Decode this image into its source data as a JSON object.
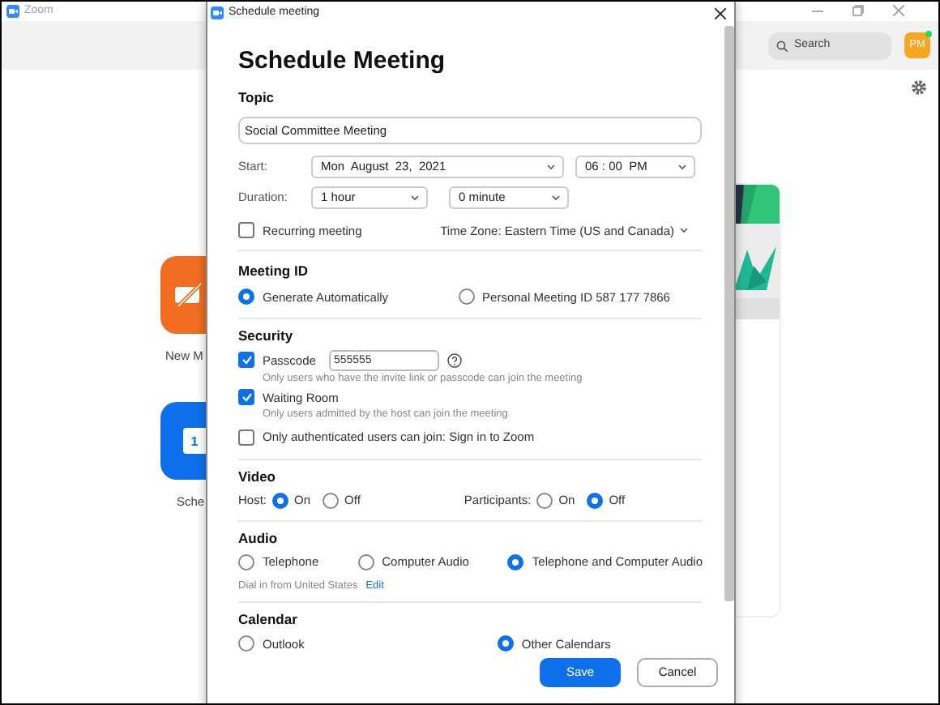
{
  "app": {
    "title": "Zoom",
    "search": {
      "placeholder": "Search"
    },
    "avatar": "PM",
    "tiles": [
      {
        "kind": "new-meeting",
        "label": "New M"
      },
      {
        "kind": "schedule",
        "label": "Sche",
        "badge": "1"
      }
    ]
  },
  "dialog": {
    "title": "Schedule meeting",
    "heading": "Schedule Meeting",
    "topic": {
      "label": "Topic",
      "value": "Social Committee Meeting"
    },
    "start": {
      "label": "Start:",
      "date": "Mon  August  23,  2021",
      "time": "06 : 00  PM"
    },
    "duration": {
      "label": "Duration:",
      "hours": "1 hour",
      "minutes": "0 minute"
    },
    "recurring": {
      "label": "Recurring meeting",
      "checked": false
    },
    "time_zone": "Time Zone: Eastern Time (US and Canada)",
    "meeting_id": {
      "label": "Meeting ID",
      "options": [
        {
          "label": "Generate Automatically",
          "selected": true
        },
        {
          "label": "Personal Meeting ID 587 177 7866",
          "selected": false
        }
      ]
    },
    "security": {
      "label": "Security",
      "items": [
        {
          "kind": "passcode",
          "label": "Passcode",
          "checked": true,
          "value": "555555",
          "hint": "Only users who have the invite link or passcode can join the meeting"
        },
        {
          "kind": "check",
          "label": "Waiting Room",
          "checked": true,
          "hint": "Only users admitted by the host can join the meeting"
        },
        {
          "kind": "check",
          "label": "Only authenticated users can join: Sign in to Zoom",
          "checked": false
        }
      ]
    },
    "video": {
      "label": "Video",
      "groups": [
        {
          "label": "Host:",
          "options": [
            {
              "label": "On",
              "selected": true
            },
            {
              "label": "Off",
              "selected": false
            }
          ]
        },
        {
          "label": "Participants:",
          "options": [
            {
              "label": "On",
              "selected": false
            },
            {
              "label": "Off",
              "selected": true
            }
          ]
        }
      ]
    },
    "audio": {
      "label": "Audio",
      "options": [
        {
          "label": "Telephone",
          "selected": false
        },
        {
          "label": "Computer Audio",
          "selected": false
        },
        {
          "label": "Telephone and Computer Audio",
          "selected": true
        }
      ],
      "dial_in": "Dial in from United States",
      "edit_link": "Edit"
    },
    "calendar": {
      "label": "Calendar",
      "options": [
        {
          "label": "Outlook",
          "selected": false
        },
        {
          "label": "Other Calendars",
          "selected": true
        }
      ]
    },
    "buttons": [
      {
        "kind": "primary",
        "label": "Save"
      },
      {
        "kind": "secondary",
        "label": "Cancel"
      }
    ]
  }
}
